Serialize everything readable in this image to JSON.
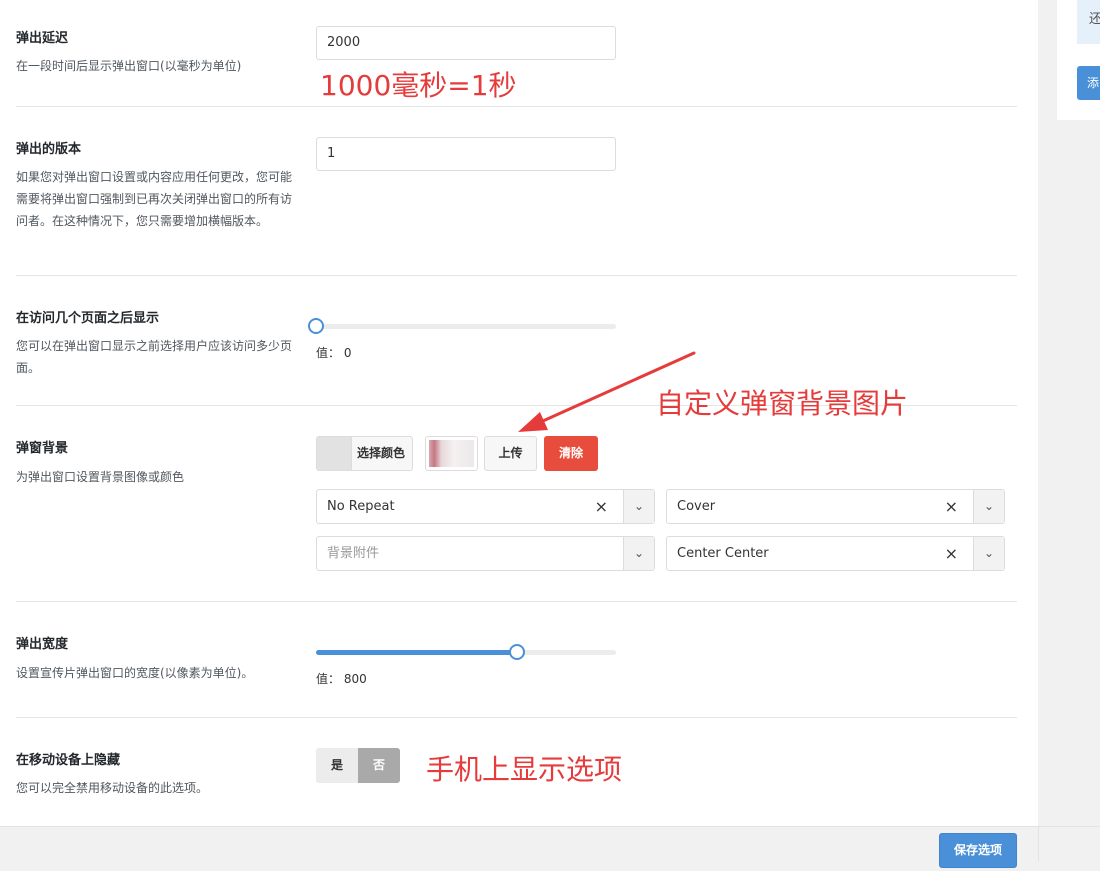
{
  "side": {
    "notice_text": "还",
    "button_text": "添"
  },
  "rows": {
    "delay": {
      "title": "弹出延迟",
      "desc": "在一段时间后显示弹出窗口(以毫秒为单位)",
      "value": "2000"
    },
    "version": {
      "title": "弹出的版本",
      "desc": "如果您对弹出窗口设置或内容应用任何更改，您可能需要将弹出窗口强制到已再次关闭弹出窗口的所有访问者。在这种情况下，您只需要增加横幅版本。",
      "value": "1"
    },
    "pages": {
      "title": "在访问几个页面之后显示",
      "desc": "您可以在弹出窗口显示之前选择用户应该访问多少页面。",
      "value_label": "值： 0",
      "level": 0
    },
    "background": {
      "title": "弹窗背景",
      "desc": "为弹出窗口设置背景图像或颜色",
      "color_label": "选择颜色",
      "upload_label": "上传",
      "clear_label": "清除",
      "repeat_value": "No Repeat",
      "size_value": "Cover",
      "attachment_placeholder": "背景附件",
      "position_value": "Center Center"
    },
    "width": {
      "title": "弹出宽度",
      "desc": "设置宣传片弹出窗口的宽度(以像素为单位)。",
      "value_label": "值： 800",
      "level": 0.67
    },
    "mobile": {
      "title": "在移动设备上隐藏",
      "desc": "您可以完全禁用移动设备的此选项。",
      "yes_label": "是",
      "no_label": "否",
      "selected": "否"
    }
  },
  "annotations": {
    "delay_note": "1000毫秒=1秒",
    "background_note": "自定义弹窗背景图片",
    "mobile_note": "手机上显示选项"
  },
  "footer": {
    "save_label": "保存选项"
  },
  "colors": {
    "accent": "#4a90d9",
    "danger": "#e74c3c",
    "annotation": "#e63b3b"
  }
}
